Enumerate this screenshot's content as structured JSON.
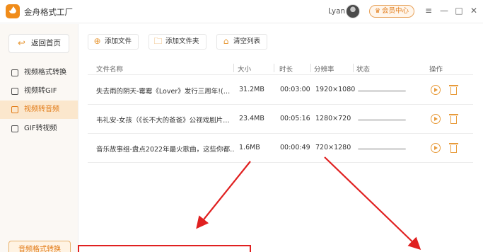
{
  "window": {
    "app_title": "金舟格式工厂",
    "username": "Lyan",
    "vip_button": "会员中心",
    "controls": {
      "menu": "≡",
      "minimize": "—",
      "maximize": "□",
      "close": "✕"
    }
  },
  "sidebar": {
    "back_label": "返回首页",
    "items": [
      {
        "label": "视频格式转换",
        "active": false
      },
      {
        "label": "视频转GIF",
        "active": false
      },
      {
        "label": "视频转音频",
        "active": true
      },
      {
        "label": "GIF转视频",
        "active": false
      }
    ],
    "bottom_button": "音频格式转换"
  },
  "toolbar": {
    "add_file": "添加文件",
    "add_folder": "添加文件夹",
    "clear_list": "清空列表"
  },
  "table": {
    "headers": {
      "name": "文件名称",
      "size": "大小",
      "duration": "时长",
      "resolution": "分辨率",
      "status": "状态",
      "actions": "操作"
    },
    "rows": [
      {
        "name": "失去雨的阴天-霉霉《Lover》发行三周年!(…",
        "size": "31.2MB",
        "duration": "00:03:00",
        "resolution": "1920×1080"
      },
      {
        "name": "韦礼安-女孩（《长不大的爸爸》公视戏剧片…",
        "size": "23.4MB",
        "duration": "00:05:16",
        "resolution": "1280×720"
      },
      {
        "name": "音乐故事组-盘点2022年最火歌曲，这些你都…",
        "size": "1.6MB",
        "duration": "00:00:49",
        "resolution": "720×1280"
      }
    ]
  },
  "colors": {
    "accent": "#e89b3b",
    "accent_text": "#e27b17",
    "annotation_red": "#e02020",
    "sidebar_active_bg": "#fbe7cd"
  }
}
